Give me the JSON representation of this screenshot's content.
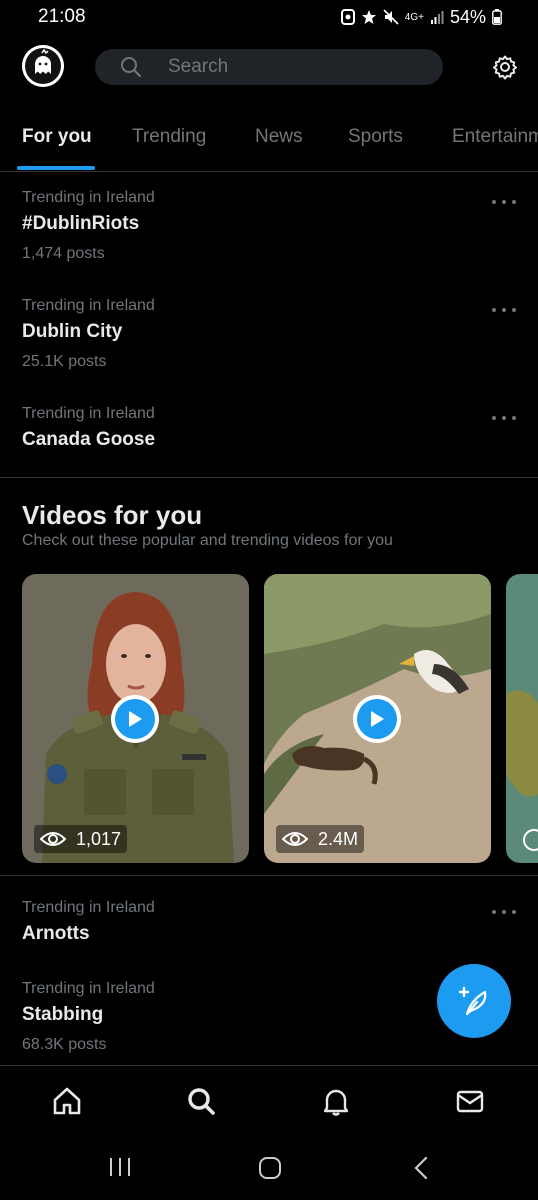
{
  "status": {
    "time": "21:08",
    "network": "4G+",
    "battery": "54%"
  },
  "header": {
    "search_placeholder": "Search"
  },
  "tabs": [
    {
      "label": "For you",
      "active": true
    },
    {
      "label": "Trending"
    },
    {
      "label": "News"
    },
    {
      "label": "Sports"
    },
    {
      "label": "Entertainment"
    }
  ],
  "trends": [
    {
      "context": "Trending in Ireland",
      "name": "#DublinRiots",
      "count": "1,474 posts"
    },
    {
      "context": "Trending in Ireland",
      "name": "Dublin City",
      "count": "25.1K posts"
    },
    {
      "context": "Trending in Ireland",
      "name": "Canada Goose",
      "count": ""
    },
    {
      "context": "Trending in Ireland",
      "name": "Arnotts",
      "count": ""
    },
    {
      "context": "Trending in Ireland",
      "name": "Stabbing",
      "count": "68.3K posts"
    }
  ],
  "videos": {
    "title": "Videos for you",
    "subtitle": "Check out these popular and trending videos for you",
    "items": [
      {
        "views": "1,017"
      },
      {
        "views": "2.4M"
      }
    ]
  },
  "colors": {
    "accent": "#1d9bf0",
    "background": "#000000",
    "secondary_text": "#71767b"
  },
  "icons": [
    "search-icon",
    "gear-icon",
    "more-icon",
    "play-icon",
    "eye-icon",
    "compose-icon",
    "home-icon",
    "explore-icon",
    "bell-icon",
    "mail-icon"
  ]
}
